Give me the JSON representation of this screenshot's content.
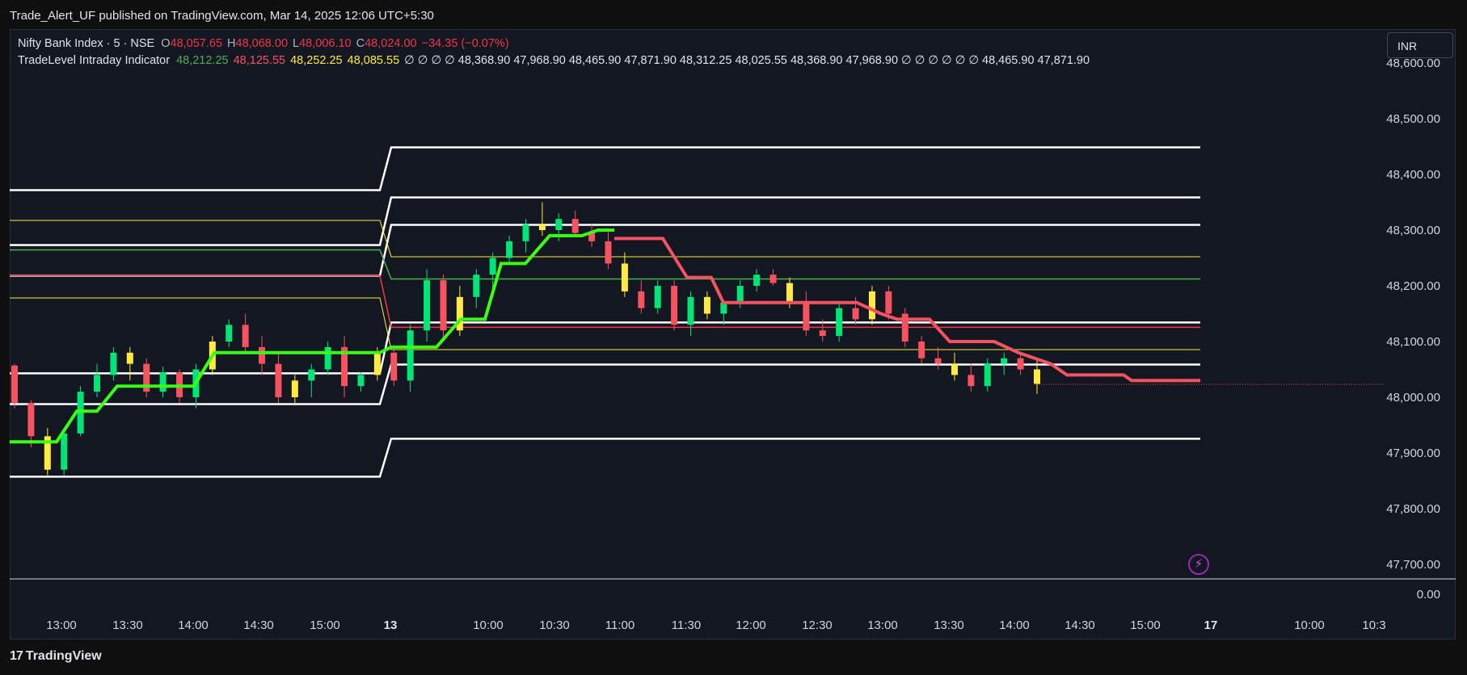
{
  "header": {
    "published": "Trade_Alert_UF published on TradingView.com, Mar 14, 2025 12:06 UTC+5:30"
  },
  "symbol": {
    "name": "Nifty Bank Index · 5 · NSE",
    "o_label": "O",
    "o": "48,057.65",
    "h_label": "H",
    "h": "48,068.00",
    "l_label": "L",
    "l": "48,006.10",
    "c_label": "C",
    "c": "48,024.00",
    "change": "−34.35 (−0.07%)"
  },
  "indicator": {
    "name": "TradeLevel Intraday Indicator",
    "v1": "48,212.25",
    "v2": "48,125.55",
    "v3": "48,252.25",
    "v4": "48,085.55",
    "rest": "∅  ∅  ∅  ∅  48,368.90  47,968.90  48,465.90  47,871.90  48,312.25  48,025.55  48,368.90  47,968.90  ∅  ∅  ∅  ∅  ∅  ∅  48,465.90  47,871.90"
  },
  "currency_button": "INR",
  "price_axis": [
    "48,600.00",
    "48,500.00",
    "48,400.00",
    "48,300.00",
    "48,200.00",
    "48,100.00",
    "48,000.00",
    "47,900.00",
    "47,800.00",
    "47,700.00",
    "0.00"
  ],
  "time_axis": [
    {
      "t": "13:00"
    },
    {
      "t": "13:30"
    },
    {
      "t": "14:00"
    },
    {
      "t": "14:30"
    },
    {
      "t": "15:00"
    },
    {
      "t": "13",
      "bold": true
    },
    {
      "t": "10:00"
    },
    {
      "t": "10:30"
    },
    {
      "t": "11:00"
    },
    {
      "t": "11:30"
    },
    {
      "t": "12:00"
    },
    {
      "t": "12:30"
    },
    {
      "t": "13:00"
    },
    {
      "t": "13:30"
    },
    {
      "t": "14:00"
    },
    {
      "t": "14:30"
    },
    {
      "t": "15:00"
    },
    {
      "t": "17",
      "bold": true
    },
    {
      "t": "10:00"
    },
    {
      "t": "10:3"
    }
  ],
  "footer": {
    "brand": "TradingView"
  },
  "icons": {
    "flash": "flash-icon",
    "logo": "tradingview-logo-icon"
  },
  "colors": {
    "up": "#00e676",
    "down": "#f7525f",
    "neutral": "#ffeb3b",
    "trail_up": "#39ff14",
    "trail_down": "#f7525f",
    "levels": "#ffffff"
  }
}
